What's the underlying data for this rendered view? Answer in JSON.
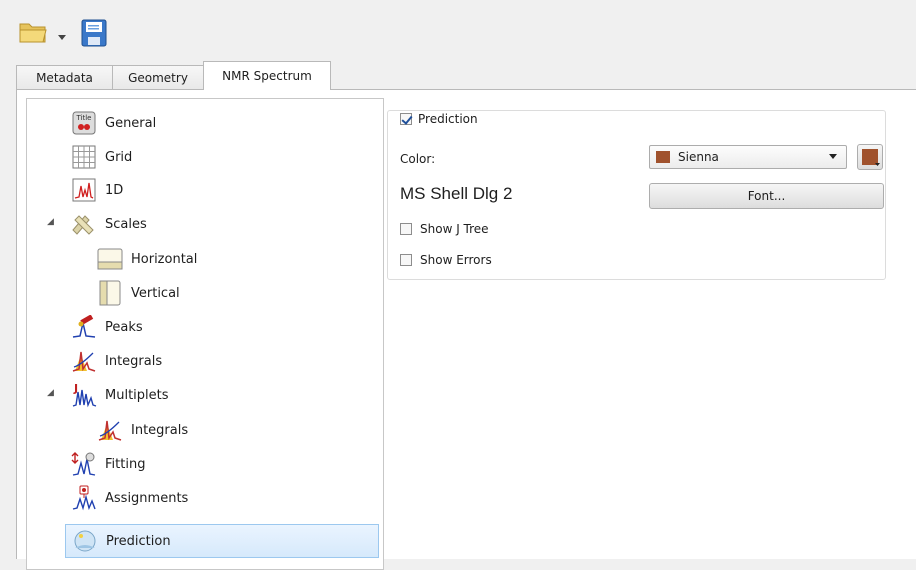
{
  "tabs": [
    "Metadata",
    "Geometry",
    "NMR Spectrum"
  ],
  "tree": {
    "items": [
      {
        "label": "General",
        "icon": "title-icon"
      },
      {
        "label": "Grid",
        "icon": "grid-icon"
      },
      {
        "label": "1D",
        "icon": "spectrum-1d-icon"
      },
      {
        "label": "Scales",
        "icon": "scales-icon"
      },
      {
        "label": "Horizontal",
        "icon": "horizontal-scale-icon"
      },
      {
        "label": "Vertical",
        "icon": "vertical-scale-icon"
      },
      {
        "label": "Peaks",
        "icon": "peaks-icon"
      },
      {
        "label": "Integrals",
        "icon": "integrals-icon"
      },
      {
        "label": "Multiplets",
        "icon": "multiplets-icon"
      },
      {
        "label": "Integrals",
        "icon": "integrals-icon"
      },
      {
        "label": "Fitting",
        "icon": "fitting-icon"
      },
      {
        "label": "Assignments",
        "icon": "assignments-icon"
      },
      {
        "label": "Prediction",
        "icon": "prediction-icon"
      }
    ],
    "selected": "Prediction"
  },
  "panel": {
    "group_title": "Prediction",
    "group_checked": true,
    "color_label": "Color:",
    "color_value": "Sienna",
    "color_hex": "#a0522d",
    "font_name": "MS Shell Dlg 2",
    "font_button": "Font...",
    "show_j_tree": "Show J Tree",
    "show_j_tree_checked": false,
    "show_errors": "Show Errors",
    "show_errors_checked": false
  },
  "colors": {
    "accent": "#1e4f9a",
    "selection": "#d6e9fb",
    "sienna": "#a0522d"
  }
}
